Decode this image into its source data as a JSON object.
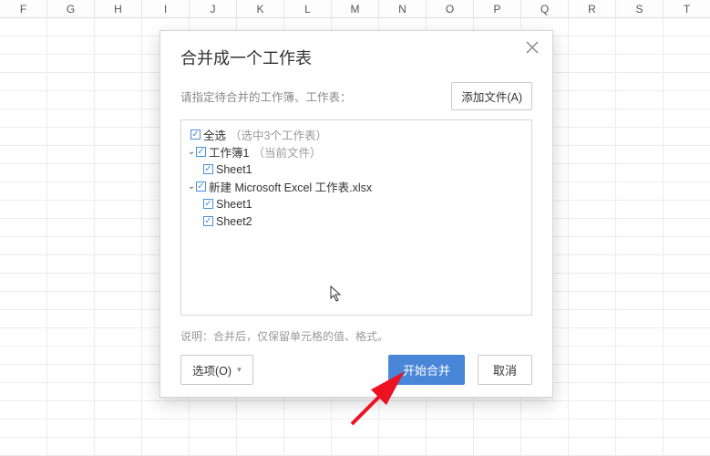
{
  "columns": [
    "F",
    "G",
    "H",
    "I",
    "J",
    "K",
    "L",
    "M",
    "N",
    "O",
    "P",
    "Q",
    "R",
    "S",
    "T"
  ],
  "dialog": {
    "title": "合并成一个工作表",
    "subtitle": "请指定待合并的工作簿、工作表：",
    "add_file": "添加文件(A)",
    "note": "说明：合并后，仅保留单元格的值、格式。",
    "options_label": "选项(O)",
    "primary_label": "开始合并",
    "cancel_label": "取消",
    "tree": {
      "select_all": "全选",
      "select_all_suffix": "（选中3个工作表）",
      "wb1": {
        "name": "工作簿1",
        "suffix": "（当前文件）",
        "sheet1": "Sheet1"
      },
      "wb2": {
        "name": "新建 Microsoft Excel 工作表.xlsx",
        "sheet1": "Sheet1",
        "sheet2": "Sheet2"
      }
    }
  }
}
